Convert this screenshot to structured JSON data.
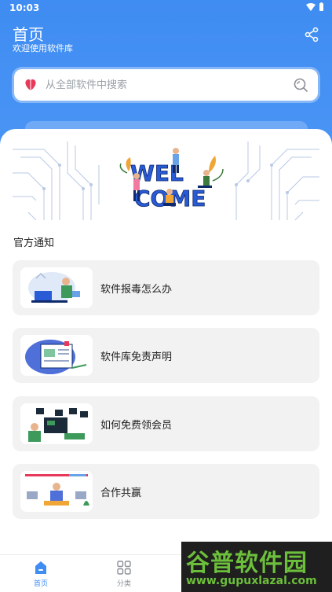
{
  "status_bar": {
    "time": "10:03"
  },
  "header": {
    "title": "首页",
    "subtitle": "欢迎使用软件库"
  },
  "search": {
    "placeholder": "从全部软件中搜索"
  },
  "section": {
    "title": "官方通知"
  },
  "notices": [
    {
      "label": "软件报毒怎么办"
    },
    {
      "label": "软件库免责声明"
    },
    {
      "label": "如何免费领会员"
    },
    {
      "label": "合作共赢"
    }
  ],
  "tabs": [
    {
      "label": "首页"
    },
    {
      "label": "分类"
    }
  ],
  "watermark": {
    "brand": "谷普软件园",
    "url": "www.gupuxlazal.com"
  },
  "colors": {
    "accent": "#3f8cf2",
    "card_bg": "#f2f2f2"
  }
}
